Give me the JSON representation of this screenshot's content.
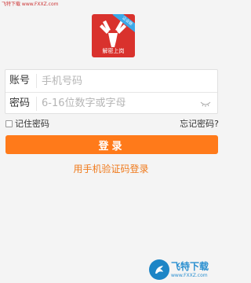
{
  "watermark": {
    "text": "飞特下载 www.FXXZ.com"
  },
  "logo": {
    "app_name": "解密上岗",
    "ribbon": "企业版",
    "icon": "deer-icon"
  },
  "form": {
    "account": {
      "label": "账号",
      "placeholder": "手机号码",
      "value": ""
    },
    "password": {
      "label": "密码",
      "placeholder": "6-16位数字或字母",
      "value": "",
      "toggle_icon": "eye-closed-icon"
    }
  },
  "options": {
    "remember_label": "记住密码",
    "remember_checked": false,
    "forgot_label": "忘记密码?"
  },
  "login_button": {
    "label": "登录",
    "color": "#ff7a1a"
  },
  "sms_login": {
    "label": "用手机验证码登录",
    "color": "#f07a1c"
  },
  "badge": {
    "site_name": "飞特下载",
    "site_url": "www.FXXZ.com"
  }
}
